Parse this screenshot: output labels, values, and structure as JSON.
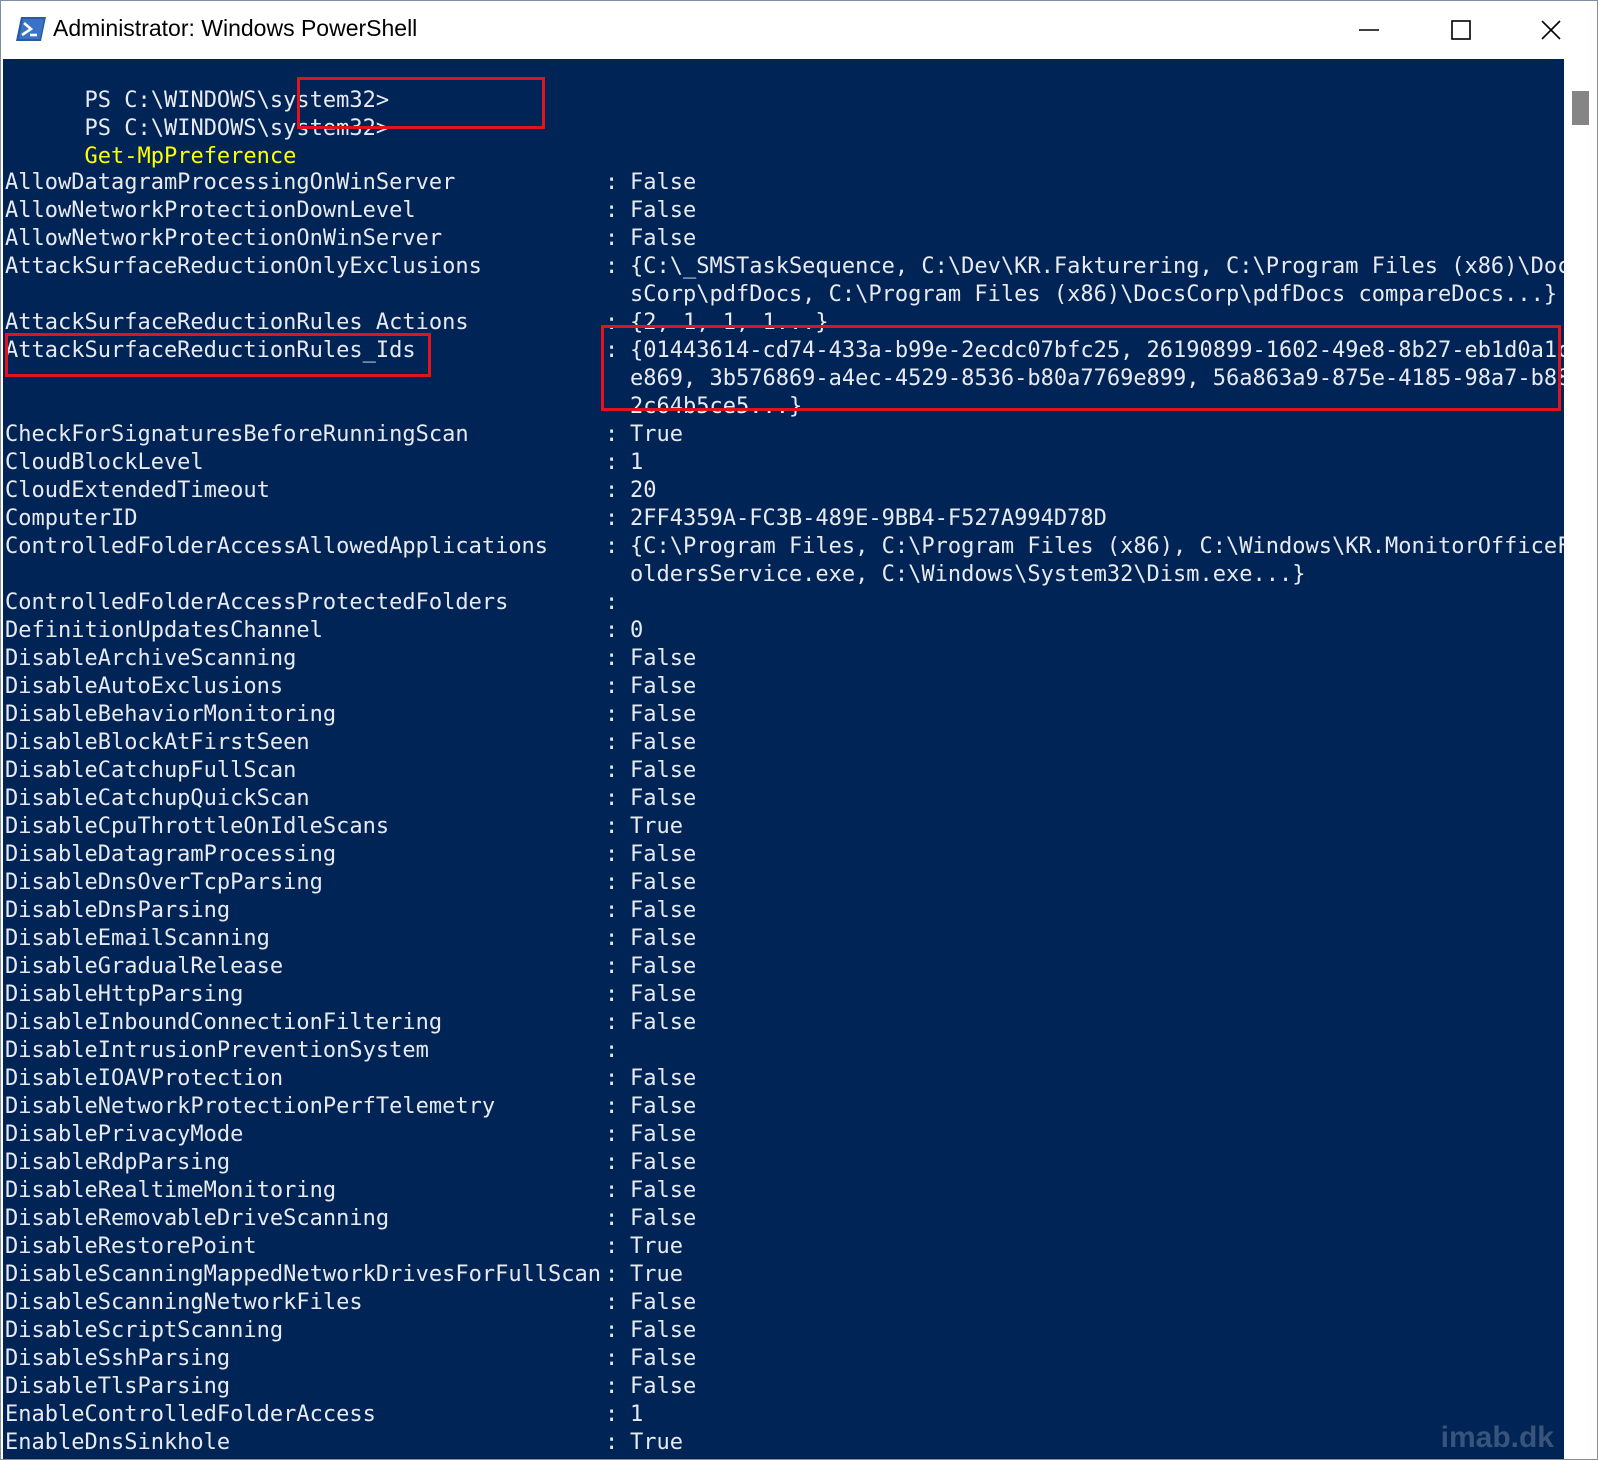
{
  "window": {
    "title": "Administrator: Windows PowerShell",
    "icon": "powershell-icon",
    "controls": [
      "minimize-icon",
      "maximize-icon",
      "close-icon"
    ]
  },
  "prompt": {
    "line1": "PS C:\\WINDOWS\\system32>",
    "line2": "PS C:\\WINDOWS\\system32>",
    "command": "Get-MpPreference"
  },
  "preferences": [
    {
      "key": "AllowDatagramProcessingOnWinServer",
      "value": "False"
    },
    {
      "key": "AllowNetworkProtectionDownLevel",
      "value": "False"
    },
    {
      "key": "AllowNetworkProtectionOnWinServer",
      "value": "False"
    },
    {
      "key": "AttackSurfaceReductionOnlyExclusions",
      "value": "{C:\\_SMSTaskSequence, C:\\Dev\\KR.Fakturering, C:\\Program Files (x86)\\Doc",
      "cont": "sCorp\\pdfDocs, C:\\Program Files (x86)\\DocsCorp\\pdfDocs compareDocs...}"
    },
    {
      "key": "AttackSurfaceReductionRules_Actions",
      "value": "{2, 1, 1, 1...}"
    },
    {
      "key": "AttackSurfaceReductionRules_Ids",
      "value": "{01443614-cd74-433a-b99e-2ecdc07bfc25, 26190899-1602-49e8-8b27-eb1d0a1c",
      "cont": "e869, 3b576869-a4ec-4529-8536-b80a7769e899, 56a863a9-875e-4185-98a7-b88",
      "cont2": "2c64b5ce5...}"
    },
    {
      "key": "CheckForSignaturesBeforeRunningScan",
      "value": "True"
    },
    {
      "key": "CloudBlockLevel",
      "value": "1"
    },
    {
      "key": "CloudExtendedTimeout",
      "value": "20"
    },
    {
      "key": "ComputerID",
      "value": "2FF4359A-FC3B-489E-9BB4-F527A994D78D"
    },
    {
      "key": "ControlledFolderAccessAllowedApplications",
      "value": "{C:\\Program Files, C:\\Program Files (x86), C:\\Windows\\KR.MonitorOfficeF",
      "cont": "oldersService.exe, C:\\Windows\\System32\\Dism.exe...}"
    },
    {
      "key": "ControlledFolderAccessProtectedFolders",
      "value": ""
    },
    {
      "key": "DefinitionUpdatesChannel",
      "value": "0"
    },
    {
      "key": "DisableArchiveScanning",
      "value": "False"
    },
    {
      "key": "DisableAutoExclusions",
      "value": "False"
    },
    {
      "key": "DisableBehaviorMonitoring",
      "value": "False"
    },
    {
      "key": "DisableBlockAtFirstSeen",
      "value": "False"
    },
    {
      "key": "DisableCatchupFullScan",
      "value": "False"
    },
    {
      "key": "DisableCatchupQuickScan",
      "value": "False"
    },
    {
      "key": "DisableCpuThrottleOnIdleScans",
      "value": "True"
    },
    {
      "key": "DisableDatagramProcessing",
      "value": "False"
    },
    {
      "key": "DisableDnsOverTcpParsing",
      "value": "False"
    },
    {
      "key": "DisableDnsParsing",
      "value": "False"
    },
    {
      "key": "DisableEmailScanning",
      "value": "False"
    },
    {
      "key": "DisableGradualRelease",
      "value": "False"
    },
    {
      "key": "DisableHttpParsing",
      "value": "False"
    },
    {
      "key": "DisableInboundConnectionFiltering",
      "value": "False"
    },
    {
      "key": "DisableIntrusionPreventionSystem",
      "value": ""
    },
    {
      "key": "DisableIOAVProtection",
      "value": "False"
    },
    {
      "key": "DisableNetworkProtectionPerfTelemetry",
      "value": "False"
    },
    {
      "key": "DisablePrivacyMode",
      "value": "False"
    },
    {
      "key": "DisableRdpParsing",
      "value": "False"
    },
    {
      "key": "DisableRealtimeMonitoring",
      "value": "False"
    },
    {
      "key": "DisableRemovableDriveScanning",
      "value": "False"
    },
    {
      "key": "DisableRestorePoint",
      "value": "True"
    },
    {
      "key": "DisableScanningMappedNetworkDrivesForFullScan",
      "value": "True"
    },
    {
      "key": "DisableScanningNetworkFiles",
      "value": "False"
    },
    {
      "key": "DisableScriptScanning",
      "value": "False"
    },
    {
      "key": "DisableSshParsing",
      "value": "False"
    },
    {
      "key": "DisableTlsParsing",
      "value": "False"
    },
    {
      "key": "EnableControlledFolderAccess",
      "value": "1"
    },
    {
      "key": "EnableDnsSinkhole",
      "value": "True"
    }
  ],
  "separator": ":",
  "watermark": "imab.dk",
  "colors": {
    "console_bg": "#012456",
    "command": "#ffff00",
    "highlight": "#e0141e"
  }
}
